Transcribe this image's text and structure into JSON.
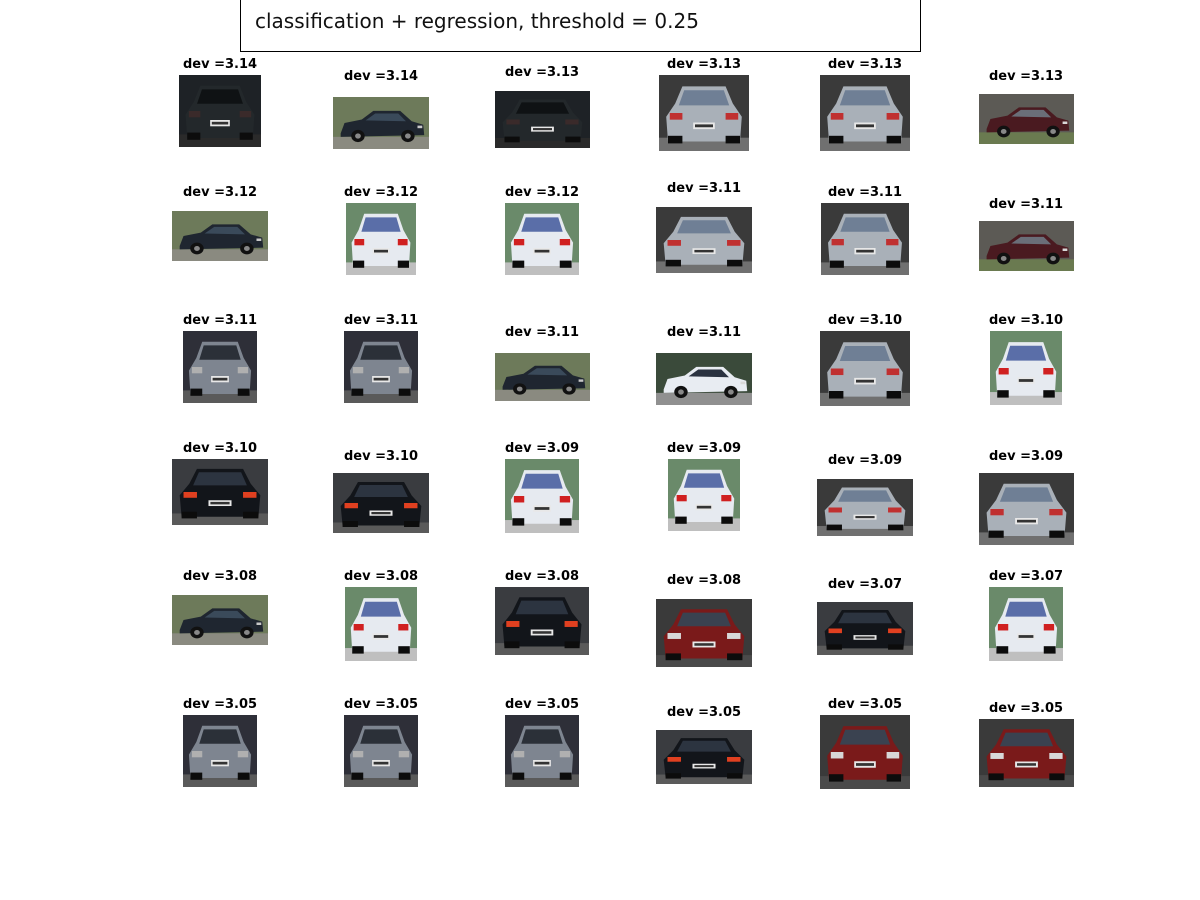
{
  "figure": {
    "title": "classification + regression, threshold = 0.25"
  },
  "grid": {
    "rows": [
      [
        {
          "label": "dev =3.14",
          "image": "car-rear-dark"
        },
        {
          "label": "dev =3.14",
          "image": "car-side-dark"
        },
        {
          "label": "dev =3.13",
          "image": "car-rear-dark"
        },
        {
          "label": "dev =3.13",
          "image": "car-rear-silver"
        },
        {
          "label": "dev =3.13",
          "image": "car-rear-silver"
        },
        {
          "label": "dev =3.13",
          "image": "car-side-red"
        }
      ],
      [
        {
          "label": "dev =3.12",
          "image": "car-side-dark"
        },
        {
          "label": "dev =3.12",
          "image": "car-rear-white"
        },
        {
          "label": "dev =3.12",
          "image": "car-rear-white"
        },
        {
          "label": "dev =3.11",
          "image": "car-rear-silver"
        },
        {
          "label": "dev =3.11",
          "image": "car-rear-silver"
        },
        {
          "label": "dev =3.11",
          "image": "car-side-red"
        }
      ],
      [
        {
          "label": "dev =3.11",
          "image": "car-rear-grey"
        },
        {
          "label": "dev =3.11",
          "image": "car-rear-grey"
        },
        {
          "label": "dev =3.11",
          "image": "car-side-dark"
        },
        {
          "label": "dev =3.11",
          "image": "car-side-white"
        },
        {
          "label": "dev =3.10",
          "image": "car-rear-silver"
        },
        {
          "label": "dev =3.10",
          "image": "car-rear-white"
        }
      ],
      [
        {
          "label": "dev =3.10",
          "image": "car-rear-black"
        },
        {
          "label": "dev =3.10",
          "image": "car-rear-black"
        },
        {
          "label": "dev =3.09",
          "image": "car-rear-white"
        },
        {
          "label": "dev =3.09",
          "image": "car-rear-white"
        },
        {
          "label": "dev =3.09",
          "image": "car-rear-silver"
        },
        {
          "label": "dev =3.09",
          "image": "car-rear-silver"
        }
      ],
      [
        {
          "label": "dev =3.08",
          "image": "car-side-dark"
        },
        {
          "label": "dev =3.08",
          "image": "car-rear-white"
        },
        {
          "label": "dev =3.08",
          "image": "car-rear-black"
        },
        {
          "label": "dev =3.08",
          "image": "car-rear-red"
        },
        {
          "label": "dev =3.07",
          "image": "car-rear-black"
        },
        {
          "label": "dev =3.07",
          "image": "car-rear-white"
        }
      ],
      [
        {
          "label": "dev =3.05",
          "image": "car-rear-grey"
        },
        {
          "label": "dev =3.05",
          "image": "car-rear-grey"
        },
        {
          "label": "dev =3.05",
          "image": "car-rear-grey"
        },
        {
          "label": "dev =3.05",
          "image": "car-rear-black"
        },
        {
          "label": "dev =3.05",
          "image": "car-rear-red"
        },
        {
          "label": "dev =3.05",
          "image": "car-rear-red"
        }
      ]
    ]
  },
  "palette": {
    "car-rear-dark": {
      "bg": "#1e2226",
      "body": "#23282b",
      "glass": "#0f1214",
      "light": "#3a2a2a",
      "ground": "#2a2a2a"
    },
    "car-side-dark": {
      "bg": "#6d7a5a",
      "body": "#1f2630",
      "glass": "#3a4a5a",
      "light": "#c8c8c8",
      "ground": "#8a8a80"
    },
    "car-rear-silver": {
      "bg": "#3a3a3a",
      "body": "#a9b0b8",
      "glass": "#6f7f95",
      "light": "#c03030",
      "ground": "#707070"
    },
    "car-side-red": {
      "bg": "#5c5a55",
      "body": "#4a1a20",
      "glass": "#6a6e78",
      "light": "#d8d8d8",
      "ground": "#6a7a50"
    },
    "car-rear-white": {
      "bg": "#6a8a6a",
      "body": "#e6eaf0",
      "glass": "#5a6ea8",
      "light": "#d02020",
      "ground": "#bfbfbf"
    },
    "car-rear-grey": {
      "bg": "#2e2f38",
      "body": "#7e8590",
      "glass": "#2b3038",
      "light": "#b0b0b0",
      "ground": "#5a5a5a"
    },
    "car-side-white": {
      "bg": "#3a4a3a",
      "body": "#e8ecf2",
      "glass": "#2a3240",
      "light": "#d8d8d8",
      "ground": "#909090"
    },
    "car-rear-black": {
      "bg": "#3a3c40",
      "body": "#12151a",
      "glass": "#2c3440",
      "light": "#e04020",
      "ground": "#5a5a5a"
    },
    "car-rear-red": {
      "bg": "#3a3a3a",
      "body": "#7a1a1a",
      "glass": "#3a4250",
      "light": "#d8d8d8",
      "ground": "#4a4a4a"
    }
  }
}
